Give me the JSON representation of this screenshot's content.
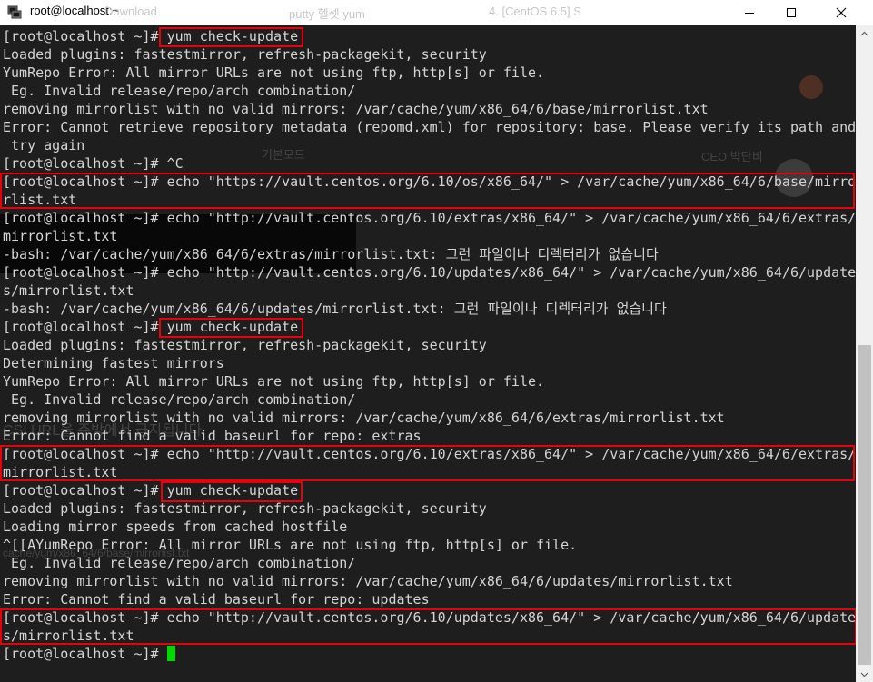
{
  "window": {
    "title": "root@localhost:~",
    "background_tabs": [
      "Download",
      "putty 헬셋 yum",
      "4. [CentOS 6.5] S"
    ]
  },
  "terminal": {
    "lines": [
      "[root@localhost ~]# yum check-update",
      "Loaded plugins: fastestmirror, refresh-packagekit, security",
      "YumRepo Error: All mirror URLs are not using ftp, http[s] or file.",
      " Eg. Invalid release/repo/arch combination/",
      "removing mirrorlist with no valid mirrors: /var/cache/yum/x86_64/6/base/mirrorlist.txt",
      "Error: Cannot retrieve repository metadata (repomd.xml) for repository: base. Please verify its path and",
      " try again",
      "[root@localhost ~]# ^C",
      "[root@localhost ~]# echo \"https://vault.centos.org/6.10/os/x86_64/\" > /var/cache/yum/x86_64/6/base/mirro",
      "rlist.txt",
      "[root@localhost ~]# echo \"http://vault.centos.org/6.10/extras/x86_64/\" > /var/cache/yum/x86_64/6/extras/",
      "mirrorlist.txt",
      "-bash: /var/cache/yum/x86_64/6/extras/mirrorlist.txt: 그런 파일이나 디렉터리가 없습니다",
      "[root@localhost ~]# echo \"http://vault.centos.org/6.10/updates/x86_64/\" > /var/cache/yum/x86_64/6/update",
      "s/mirrorlist.txt",
      "-bash: /var/cache/yum/x86_64/6/updates/mirrorlist.txt: 그런 파일이나 디렉터리가 없습니다",
      "[root@localhost ~]# yum check-update",
      "Loaded plugins: fastestmirror, refresh-packagekit, security",
      "Determining fastest mirrors",
      "YumRepo Error: All mirror URLs are not using ftp, http[s] or file.",
      " Eg. Invalid release/repo/arch combination/",
      "removing mirrorlist with no valid mirrors: /var/cache/yum/x86_64/6/extras/mirrorlist.txt",
      "Error: Cannot find a valid baseurl for repo: extras",
      "[root@localhost ~]# echo \"http://vault.centos.org/6.10/extras/x86_64/\" > /var/cache/yum/x86_64/6/extras/",
      "mirrorlist.txt",
      "[root@localhost ~]# yum check-update",
      "Loaded plugins: fastestmirror, refresh-packagekit, security",
      "Loading mirror speeds from cached hostfile",
      "^[[AYumRepo Error: All mirror URLs are not using ftp, http[s] or file.",
      " Eg. Invalid release/repo/arch combination/",
      "removing mirrorlist with no valid mirrors: /var/cache/yum/x86_64/6/updates/mirrorlist.txt",
      "Error: Cannot find a valid baseurl for repo: updates",
      "[root@localhost ~]# echo \"http://vault.centos.org/6.10/updates/x86_64/\" > /var/cache/yum/x86_64/6/update",
      "s/mirrorlist.txt"
    ],
    "final_prompt": "[root@localhost ~]# "
  },
  "ghost_overlay": {
    "style_label": "기본모드",
    "author": "CEO 박단비",
    "heading": "CSI URL을 주방에서 급지됩니다",
    "path_hint": "cache/yum/x86_64/6/base/mirrorlist.txt"
  },
  "colors": {
    "terminal_bg": "#1e1e1e",
    "terminal_fg": "#d4d4d4",
    "cursor": "#00d800",
    "highlight": "#e8000c"
  }
}
